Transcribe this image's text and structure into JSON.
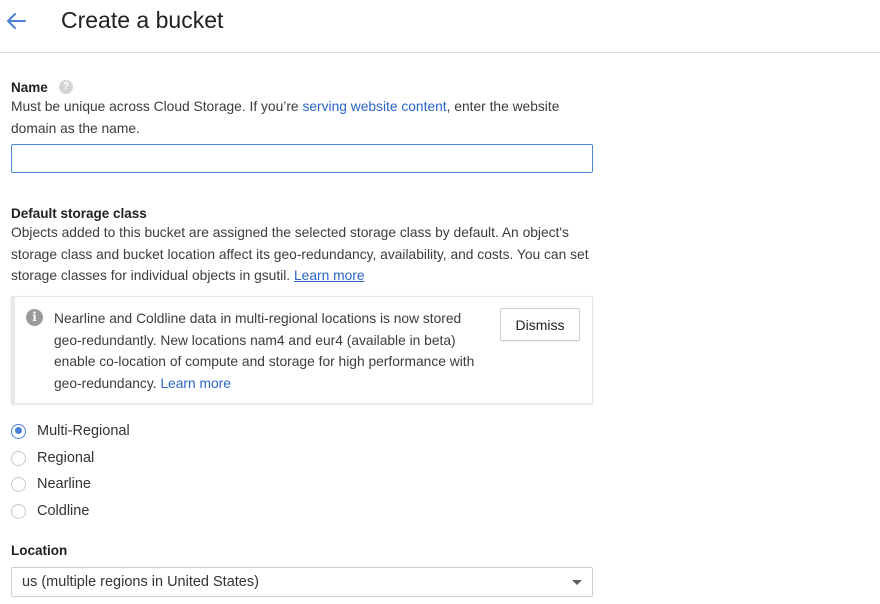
{
  "header": {
    "title": "Create a bucket"
  },
  "name_section": {
    "label": "Name",
    "desc_before": "Must be unique across Cloud Storage. If you’re ",
    "desc_link": "serving website content",
    "desc_after": ", enter the website domain as the name.",
    "input_value": ""
  },
  "storage_section": {
    "label": "Default storage class",
    "desc": "Objects added to this bucket are assigned the selected storage class by default. An object's storage class and bucket location affect its geo-redundancy, availability, and costs. You can set storage classes for individual objects in gsutil. ",
    "learn_more": "Learn more"
  },
  "notice": {
    "text": "Nearline and Coldline data in multi-regional locations is now stored geo-redundantly. New locations nam4 and eur4 (available in beta) enable co-location of compute and storage for high performance with geo-redundancy. ",
    "learn_more": "Learn more",
    "dismiss_label": "Dismiss"
  },
  "storage_classes": [
    {
      "label": "Multi-Regional",
      "checked": true
    },
    {
      "label": "Regional",
      "checked": false
    },
    {
      "label": "Nearline",
      "checked": false
    },
    {
      "label": "Coldline",
      "checked": false
    }
  ],
  "location": {
    "label": "Location",
    "selected": "us (multiple regions in United States)"
  },
  "colors": {
    "accent": "#4a80d8",
    "link": "#2b65c9"
  }
}
